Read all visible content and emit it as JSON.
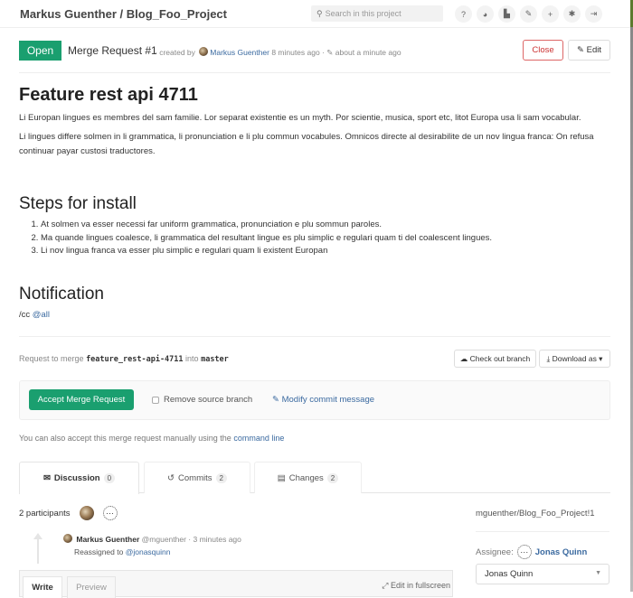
{
  "header": {
    "project_title": "Markus Guenther / Blog_Foo_Project",
    "search_placeholder": "Search in this project",
    "nav_icons": [
      {
        "name": "help-icon",
        "glyph": "?"
      },
      {
        "name": "explore-icon",
        "glyph": "◕"
      },
      {
        "name": "snippets-icon",
        "glyph": "▙"
      },
      {
        "name": "admin-wrench-icon",
        "glyph": "✎"
      },
      {
        "name": "new-plus-icon",
        "glyph": "+"
      },
      {
        "name": "settings-gear-icon",
        "glyph": "✱"
      },
      {
        "name": "sign-out-icon",
        "glyph": "⇥"
      }
    ]
  },
  "merge_request": {
    "status": "Open",
    "title": "Merge Request #1",
    "created_by_label": "· created by",
    "author": "Markus Guenther",
    "created_time": "8 minutes ago",
    "edited_time": "about a minute ago",
    "close_label": "Close",
    "edit_label": "Edit"
  },
  "description": {
    "title": "Feature rest api 4711",
    "paragraphs": [
      "Li Europan lingues es membres del sam familie. Lor separat existentie es un myth. Por scientie, musica, sport etc, litot Europa usa li sam vocabular.",
      "Li lingues differe solmen in li grammatica, li pronunciation e li plu commun vocabules. Omnicos directe al desirabilite de un nov lingua franca: On refusa continuar payar custosi traductores."
    ],
    "steps_title": "Steps for install",
    "steps": [
      "At solmen va esser necessi far uniform grammatica, pronunciation e plu sommun paroles.",
      "Ma quande lingues coalesce, li grammatica del resultant lingue es plu simplic e regulari quam ti del coalescent lingues.",
      "Li nov lingua franca va esser plu simplic e regulari quam li existent Europan"
    ],
    "notification_title": "Notification",
    "cc_prefix": "/cc",
    "cc_mention": "@all"
  },
  "merge": {
    "request_label": "Request to merge",
    "source_branch": "feature_rest-api-4711",
    "into_label": "into",
    "target_branch": "master",
    "checkout_label": "Check out branch",
    "download_label": "Download as",
    "accept_label": "Accept Merge Request",
    "remove_source_label": "Remove source branch",
    "remove_source_checked": false,
    "modify_commit_label": "Modify commit message",
    "manual_text": "You can also accept this merge request manually using the",
    "manual_link": "command line"
  },
  "tabs": [
    {
      "label": "Discussion",
      "count": "0",
      "active": true
    },
    {
      "label": "Commits",
      "count": "2",
      "active": false
    },
    {
      "label": "Changes",
      "count": "2",
      "active": false
    }
  ],
  "discussion": {
    "participants_label": "2 participants",
    "note": {
      "author": "Markus Guenther",
      "handle": "@mguenther",
      "time": "· 3 minutes ago",
      "body_prefix": "Reassigned to",
      "body_mention": "@jonasquinn"
    },
    "editor": {
      "write_tab": "Write",
      "preview_tab": "Preview",
      "fullscreen_label": "Edit in fullscreen"
    }
  },
  "sidebar": {
    "reference": "mguenther/Blog_Foo_Project!1",
    "assignee_label": "Assignee:",
    "assignee_name": "Jonas Quinn",
    "assignee_select_value": "Jonas Quinn"
  },
  "colors": {
    "accent_green": "#1a9f6f",
    "link_blue": "#3b6aa0",
    "close_red": "#cc3333"
  }
}
